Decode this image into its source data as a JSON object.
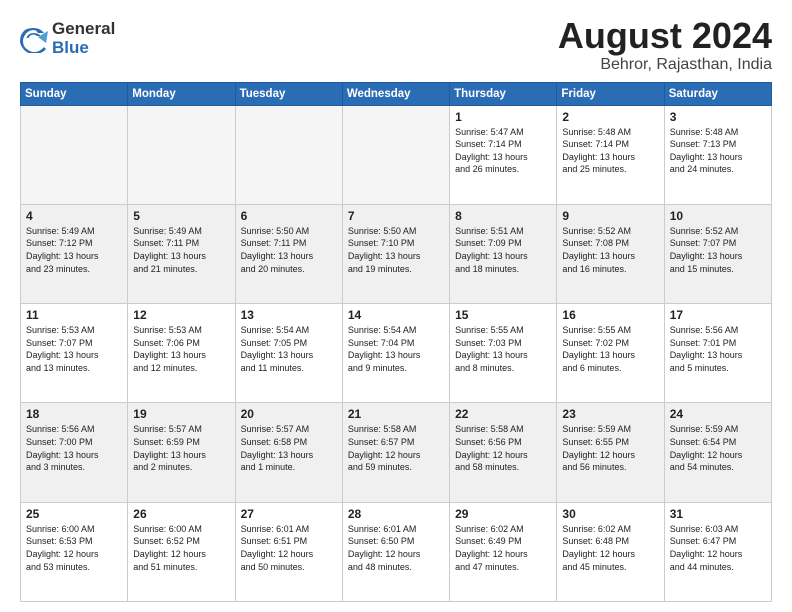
{
  "logo": {
    "general": "General",
    "blue": "Blue"
  },
  "title": "August 2024",
  "location": "Behror, Rajasthan, India",
  "days_of_week": [
    "Sunday",
    "Monday",
    "Tuesday",
    "Wednesday",
    "Thursday",
    "Friday",
    "Saturday"
  ],
  "weeks": [
    [
      {
        "day": "",
        "info": ""
      },
      {
        "day": "",
        "info": ""
      },
      {
        "day": "",
        "info": ""
      },
      {
        "day": "",
        "info": ""
      },
      {
        "day": "1",
        "info": "Sunrise: 5:47 AM\nSunset: 7:14 PM\nDaylight: 13 hours\nand 26 minutes."
      },
      {
        "day": "2",
        "info": "Sunrise: 5:48 AM\nSunset: 7:14 PM\nDaylight: 13 hours\nand 25 minutes."
      },
      {
        "day": "3",
        "info": "Sunrise: 5:48 AM\nSunset: 7:13 PM\nDaylight: 13 hours\nand 24 minutes."
      }
    ],
    [
      {
        "day": "4",
        "info": "Sunrise: 5:49 AM\nSunset: 7:12 PM\nDaylight: 13 hours\nand 23 minutes."
      },
      {
        "day": "5",
        "info": "Sunrise: 5:49 AM\nSunset: 7:11 PM\nDaylight: 13 hours\nand 21 minutes."
      },
      {
        "day": "6",
        "info": "Sunrise: 5:50 AM\nSunset: 7:11 PM\nDaylight: 13 hours\nand 20 minutes."
      },
      {
        "day": "7",
        "info": "Sunrise: 5:50 AM\nSunset: 7:10 PM\nDaylight: 13 hours\nand 19 minutes."
      },
      {
        "day": "8",
        "info": "Sunrise: 5:51 AM\nSunset: 7:09 PM\nDaylight: 13 hours\nand 18 minutes."
      },
      {
        "day": "9",
        "info": "Sunrise: 5:52 AM\nSunset: 7:08 PM\nDaylight: 13 hours\nand 16 minutes."
      },
      {
        "day": "10",
        "info": "Sunrise: 5:52 AM\nSunset: 7:07 PM\nDaylight: 13 hours\nand 15 minutes."
      }
    ],
    [
      {
        "day": "11",
        "info": "Sunrise: 5:53 AM\nSunset: 7:07 PM\nDaylight: 13 hours\nand 13 minutes."
      },
      {
        "day": "12",
        "info": "Sunrise: 5:53 AM\nSunset: 7:06 PM\nDaylight: 13 hours\nand 12 minutes."
      },
      {
        "day": "13",
        "info": "Sunrise: 5:54 AM\nSunset: 7:05 PM\nDaylight: 13 hours\nand 11 minutes."
      },
      {
        "day": "14",
        "info": "Sunrise: 5:54 AM\nSunset: 7:04 PM\nDaylight: 13 hours\nand 9 minutes."
      },
      {
        "day": "15",
        "info": "Sunrise: 5:55 AM\nSunset: 7:03 PM\nDaylight: 13 hours\nand 8 minutes."
      },
      {
        "day": "16",
        "info": "Sunrise: 5:55 AM\nSunset: 7:02 PM\nDaylight: 13 hours\nand 6 minutes."
      },
      {
        "day": "17",
        "info": "Sunrise: 5:56 AM\nSunset: 7:01 PM\nDaylight: 13 hours\nand 5 minutes."
      }
    ],
    [
      {
        "day": "18",
        "info": "Sunrise: 5:56 AM\nSunset: 7:00 PM\nDaylight: 13 hours\nand 3 minutes."
      },
      {
        "day": "19",
        "info": "Sunrise: 5:57 AM\nSunset: 6:59 PM\nDaylight: 13 hours\nand 2 minutes."
      },
      {
        "day": "20",
        "info": "Sunrise: 5:57 AM\nSunset: 6:58 PM\nDaylight: 13 hours\nand 1 minute."
      },
      {
        "day": "21",
        "info": "Sunrise: 5:58 AM\nSunset: 6:57 PM\nDaylight: 12 hours\nand 59 minutes."
      },
      {
        "day": "22",
        "info": "Sunrise: 5:58 AM\nSunset: 6:56 PM\nDaylight: 12 hours\nand 58 minutes."
      },
      {
        "day": "23",
        "info": "Sunrise: 5:59 AM\nSunset: 6:55 PM\nDaylight: 12 hours\nand 56 minutes."
      },
      {
        "day": "24",
        "info": "Sunrise: 5:59 AM\nSunset: 6:54 PM\nDaylight: 12 hours\nand 54 minutes."
      }
    ],
    [
      {
        "day": "25",
        "info": "Sunrise: 6:00 AM\nSunset: 6:53 PM\nDaylight: 12 hours\nand 53 minutes."
      },
      {
        "day": "26",
        "info": "Sunrise: 6:00 AM\nSunset: 6:52 PM\nDaylight: 12 hours\nand 51 minutes."
      },
      {
        "day": "27",
        "info": "Sunrise: 6:01 AM\nSunset: 6:51 PM\nDaylight: 12 hours\nand 50 minutes."
      },
      {
        "day": "28",
        "info": "Sunrise: 6:01 AM\nSunset: 6:50 PM\nDaylight: 12 hours\nand 48 minutes."
      },
      {
        "day": "29",
        "info": "Sunrise: 6:02 AM\nSunset: 6:49 PM\nDaylight: 12 hours\nand 47 minutes."
      },
      {
        "day": "30",
        "info": "Sunrise: 6:02 AM\nSunset: 6:48 PM\nDaylight: 12 hours\nand 45 minutes."
      },
      {
        "day": "31",
        "info": "Sunrise: 6:03 AM\nSunset: 6:47 PM\nDaylight: 12 hours\nand 44 minutes."
      }
    ]
  ]
}
